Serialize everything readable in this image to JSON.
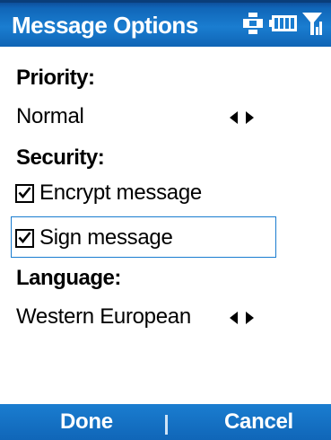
{
  "title": "Message Options",
  "status_icons": [
    "connectivity-icon",
    "battery-icon",
    "signal-icon"
  ],
  "priority": {
    "label": "Priority:",
    "value": "Normal"
  },
  "security": {
    "label": "Security:",
    "options": [
      {
        "label": "Encrypt message",
        "checked": true
      },
      {
        "label": "Sign message",
        "checked": true,
        "focused": true
      }
    ]
  },
  "language": {
    "label": "Language:",
    "value": "Western European"
  },
  "softkeys": {
    "left": "Done",
    "right": "Cancel"
  },
  "colors": {
    "bar_blue": "#1a7dd0",
    "text": "#000000"
  }
}
